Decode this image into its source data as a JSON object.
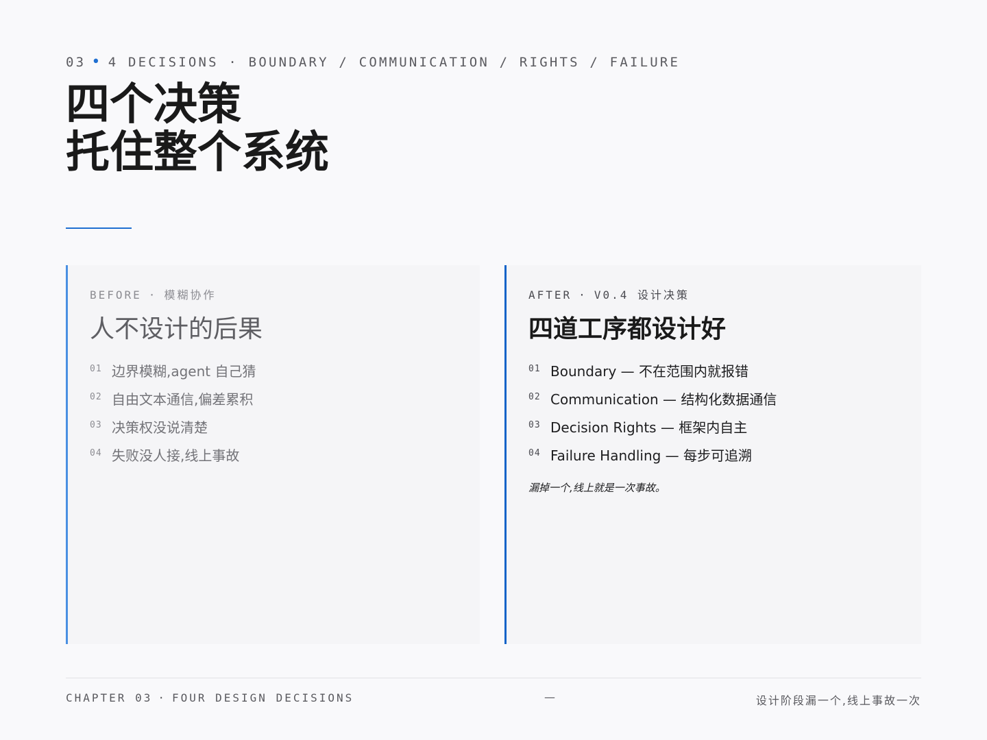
{
  "header": {
    "chapter_num": "03",
    "dot": "•",
    "topics": "4 DECISIONS · BOUNDARY / COMMUNICATION / RIGHTS / FAILURE",
    "title_line1": "四个决策",
    "title_line2": "托住整个系统"
  },
  "before": {
    "label": "BEFORE",
    "sep": "·",
    "sublabel": "模糊协作",
    "title": "人不设计的后果",
    "items": [
      {
        "num": "01",
        "text": "边界模糊,agent 自己猜"
      },
      {
        "num": "02",
        "text": "自由文本通信,偏差累积"
      },
      {
        "num": "03",
        "text": "决策权没说清楚"
      },
      {
        "num": "04",
        "text": "失败没人接,线上事故"
      }
    ]
  },
  "after": {
    "label": "AFTER",
    "sep": "·",
    "sublabel": "V0.4 设计决策",
    "title": "四道工序都设计好",
    "items": [
      {
        "num": "01",
        "text": "Boundary — 不在范围内就报错"
      },
      {
        "num": "02",
        "text": "Communication — 结构化数据通信"
      },
      {
        "num": "03",
        "text": "Decision Rights — 框架内自主"
      },
      {
        "num": "04",
        "text": "Failure Handling — 每步可追溯"
      }
    ],
    "note": "漏掉一个,线上就是一次事故。"
  },
  "footer": {
    "chapter": "CHAPTER 03",
    "sep": "·",
    "section": "FOUR DESIGN DECISIONS",
    "center": "—",
    "right": "设计阶段漏一个,线上事故一次"
  },
  "colors": {
    "accent": "#1f6fd1",
    "background": "#f9f9fb",
    "card": "#f5f5f7"
  }
}
